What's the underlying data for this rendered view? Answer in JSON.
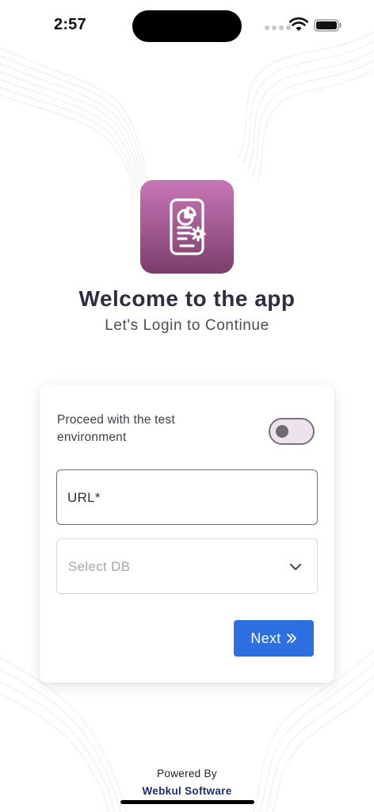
{
  "status_bar": {
    "time": "2:57",
    "icons": [
      "cellular-signal-icon",
      "wifi-icon",
      "battery-icon"
    ]
  },
  "header": {
    "logo_icon": "phone-dashboard-settings-icon",
    "logo_gradient": [
      "#c877b6",
      "#7b3e6c"
    ],
    "title": "Welcome to the app",
    "subtitle": "Let's Login to Continue"
  },
  "form": {
    "test_env_label": "Proceed with the test environment",
    "test_env_enabled": false,
    "url_field": {
      "label": "URL*",
      "value": ""
    },
    "db_select": {
      "placeholder": "Select DB",
      "icon": "chevron-down-icon"
    },
    "next_button": {
      "label": "Next",
      "icon": "double-chevron-right-icon"
    }
  },
  "footer": {
    "powered_by": "Powered By",
    "company": "Webkul Software"
  },
  "colors": {
    "primary_button": "#2d6fe0",
    "title_text": "#2b2f40",
    "company_text": "#1c2e6e"
  }
}
